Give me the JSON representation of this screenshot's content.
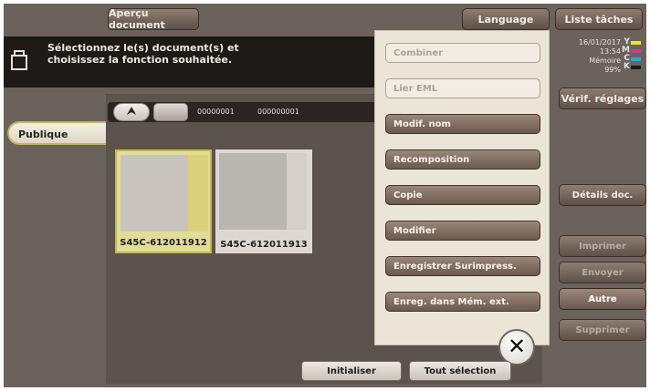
{
  "header": {
    "preview_button": "Aperçu document",
    "language_button": "Language",
    "job_list_button": "Liste tâches"
  },
  "message": {
    "line1": "Sélectionnez le(s) document(s) et",
    "line2": "choisissez la fonction souhaitée."
  },
  "status": {
    "date": "16/01/2017",
    "time": "13:54",
    "memory_label": "Mémoire",
    "memory_percent": "99%",
    "toner_letters": [
      "Y",
      "M",
      "C",
      "K"
    ],
    "toner_colors": [
      "#f2e12a",
      "#d23c8c",
      "#2aa7d9",
      "#1a1a1a"
    ],
    "check_settings_button": "Vérif. réglages"
  },
  "tabs": {
    "public_label": "Publique"
  },
  "path": {
    "up_icon": "arrow-up-icon",
    "folder_id": "00000001",
    "box_number": "000000001"
  },
  "documents": [
    {
      "name": "S45C-612011912",
      "selected": true
    },
    {
      "name": "S45C-612011913",
      "selected": false
    }
  ],
  "menu": {
    "items": [
      {
        "label": "Combiner",
        "enabled": false
      },
      {
        "label": "Lier EML",
        "enabled": false
      },
      {
        "label": "Modif. nom",
        "enabled": true
      },
      {
        "label": "Recomposition",
        "enabled": true
      },
      {
        "label": "Copie",
        "enabled": true
      },
      {
        "label": "Modifier",
        "enabled": true
      },
      {
        "label": "Enregistrer Surimpress.",
        "enabled": true
      },
      {
        "label": "Enreg. dans Mém. ext.",
        "enabled": true
      }
    ],
    "close_icon": "close-icon",
    "close_glyph": "✕"
  },
  "sidebar": {
    "details_button": "Détails doc.",
    "print_button": "Imprimer",
    "send_button": "Envoyer",
    "other_button": "Autre",
    "delete_button": "Supprimer"
  },
  "footer": {
    "reset_button": "Initialiser",
    "select_all_button": "Tout sélection"
  }
}
